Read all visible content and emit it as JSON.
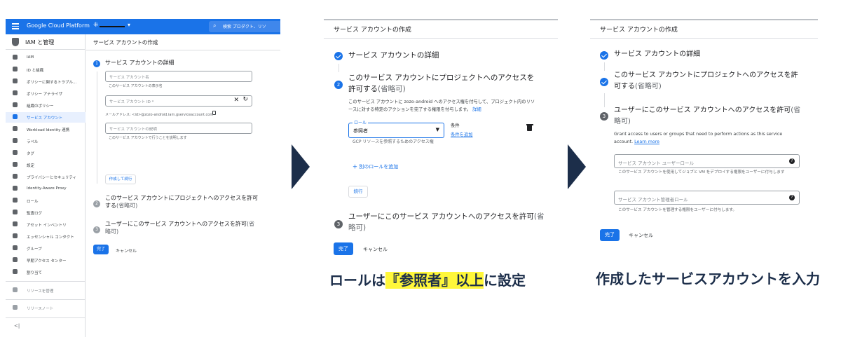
{
  "panel1": {
    "topbar": {
      "brand": "Google Cloud Platform",
      "caret": "▾",
      "search_text": "検索 プロダクト、リソ"
    },
    "sidebar": {
      "title": "IAM と管理",
      "items": [
        {
          "label": "IAM",
          "icon": "person-add-icon"
        },
        {
          "label": "ID と組織",
          "icon": "account-circle-icon"
        },
        {
          "label": "ポリシーに関するトラブル...",
          "icon": "wrench-icon"
        },
        {
          "label": "ポリシー アナライザ",
          "icon": "analyzer-icon"
        },
        {
          "label": "組織のポリシー",
          "icon": "policy-icon"
        },
        {
          "label": "サービス アカウント",
          "icon": "service-account-icon"
        },
        {
          "label": "Workload Identity 連携",
          "icon": "id-card-icon"
        },
        {
          "label": "ラベル",
          "icon": "label-icon"
        },
        {
          "label": "タグ",
          "icon": "tag-icon"
        },
        {
          "label": "設定",
          "icon": "gear-icon"
        },
        {
          "label": "プライバシーとセキュリティ",
          "icon": "shield-icon"
        },
        {
          "label": "Identity-Aware Proxy",
          "icon": "iap-icon"
        },
        {
          "label": "ロール",
          "icon": "roles-icon"
        },
        {
          "label": "監査ログ",
          "icon": "audit-log-icon"
        },
        {
          "label": "アセット インベントリ",
          "icon": "inventory-icon"
        },
        {
          "label": "エッセンシャル コンタクト",
          "icon": "contacts-icon"
        },
        {
          "label": "グループ",
          "icon": "group-icon"
        },
        {
          "label": "早期アクセス センター",
          "icon": "early-access-icon"
        },
        {
          "label": "割り当て",
          "icon": "quota-icon"
        }
      ],
      "bottom_items": [
        {
          "label": "リソースを管理",
          "icon": "manage-resources-icon"
        },
        {
          "label": "リリースノート",
          "icon": "release-notes-icon"
        }
      ],
      "collapse": "<|"
    },
    "main": {
      "title": "サービス アカウントの作成",
      "step1": {
        "num": "1",
        "title": "サービス アカウントの詳細",
        "name_placeholder": "サービス アカウント名",
        "name_help": "このサービス アカウントの表示名",
        "id_placeholder": "サービス アカウント ID *",
        "email_label": "メールアドレス: <id>@zozo-android.iam.gserviceaccount.com",
        "desc_placeholder": "サービス アカウントの説明",
        "desc_help": "このサービス アカウントで行うことを説明します",
        "create_button": "作成して続行"
      },
      "step2": {
        "num": "2",
        "title": "このサービス アカウントにプロジェクトへのアクセスを許可する",
        "optional": "(省略可)"
      },
      "step3": {
        "num": "3",
        "title": "ユーザーにこのサービス アカウントへのアクセスを許可",
        "optional": "(省略可)"
      },
      "done_button": "完了",
      "cancel_button": "キャンセル"
    }
  },
  "panel2": {
    "title": "サービス アカウントの作成",
    "step1_title": "サービス アカウントの詳細",
    "step2": {
      "num": "2",
      "title": "このサービス アカウントにプロジェクトへのアクセスを許可する",
      "optional": "(省略可)",
      "description": "このサービス アカウントに zozo-android へのアクセス権を付与して、プロジェクト内のリソースに対する特定のアクションを完了する権限を付与します。",
      "detail_link": "詳細",
      "role_label": "ロール",
      "role_value": "参照者",
      "role_help": "GCP リソースを参照するためのアクセス権",
      "condition_label": "条件",
      "condition_add": "条件を追加",
      "add_role": "別のロールを追加",
      "continue_button": "続行"
    },
    "step3": {
      "num": "3",
      "title": "ユーザーにこのサービス アカウントへのアクセスを許可",
      "optional": "(省略可)"
    },
    "done_button": "完了",
    "cancel_button": "キャンセル"
  },
  "caption2": {
    "prefix": "ロールは",
    "highlight": "『参照者』以上",
    "suffix": "に設定"
  },
  "panel3": {
    "title": "サービス アカウントの作成",
    "step1_title": "サービス アカウントの詳細",
    "step2_title": "このサービス アカウントにプロジェクトへのアクセスを許可する",
    "step2_optional": "(省略可)",
    "step3": {
      "num": "3",
      "title": "ユーザーにこのサービス アカウントへのアクセスを許可",
      "optional": "(省略可)",
      "description": "Grant access to users or groups that need to perform actions as this service account.",
      "learn_more": "Learn more",
      "user_role_placeholder": "サービス アカウント ユーザーロール",
      "user_role_help": "このサービス アカウントを使用してジョブと VM をデプロイする権限をユーザーに付与します",
      "admin_role_placeholder": "サービス アカウント管理者ロール",
      "admin_role_help": "このサービス アカウントを管理する権限をユーザーに付与します。"
    },
    "done_button": "完了",
    "cancel_button": "キャンセル"
  },
  "caption3": "作成したサービスアカウントを入力",
  "colors": {
    "accent": "#1a73e8",
    "caption": "#1c2e4a",
    "highlight": "#fff73a"
  }
}
